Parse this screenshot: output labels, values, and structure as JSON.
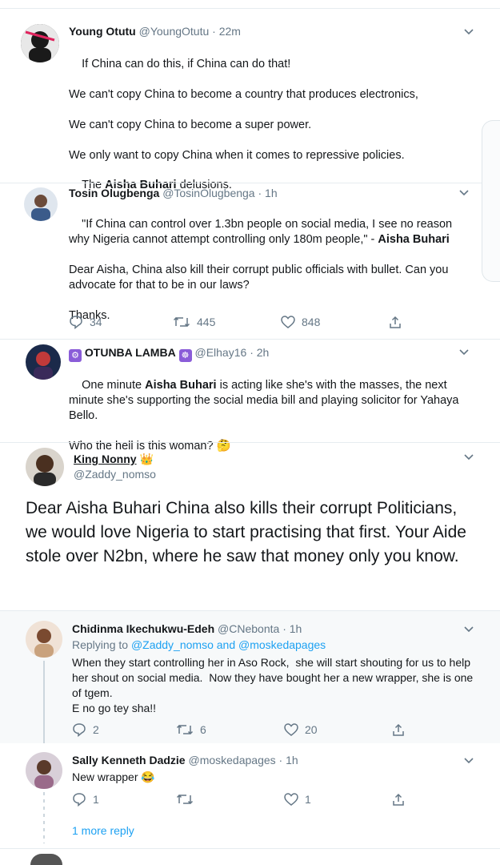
{
  "tweets": [
    {
      "name": "Young Otutu",
      "handle": "@YoungOtutu",
      "time": "22m",
      "body": "If China can do this, if China can do that!\n\nWe can't copy China to become a country that produces electronics,\n\nWe can't copy China to become a super power.\n\nWe only want to copy China when it comes to repressive policies.",
      "last_line_before": "The ",
      "last_line_bold": "Aisha Buhari",
      "last_line_after": " delusions."
    },
    {
      "name": "Tosin Olugbenga",
      "handle": "@TosinOlugbenga",
      "time": "1h",
      "body_a": "\"If China can control over 1.3bn people on social media, I see no reason why Nigeria cannot attempt controlling only 180m people,\" - ",
      "body_bold": "Aisha Buhari",
      "body_b": "\n\nDear Aisha, China also kill their corrupt public officials with bullet. Can you advocate for that to be in our laws?\n\nThanks.",
      "replies": "34",
      "retweets": "445",
      "likes": "848"
    },
    {
      "name": "OTUNBA LAMBA",
      "handle": "@Elhay16",
      "time": "2h",
      "body_a": "One minute ",
      "body_bold": "Aisha Buhari",
      "body_b": " is acting like she's with the masses, the next minute she's supporting the social media bill and playing solicitor for Yahaya Bello.\n\nWho the hell is this woman? 🤔"
    },
    {
      "name": "King Nonny",
      "handle": "@Zaddy_nomso",
      "body": "Dear Aisha Buhari China also kills their corrupt Politicians, we would love Nigeria to start practising that first. Your Aide stole over N2bn, where he saw that money only you know."
    },
    {
      "name": "Chidinma Ikechukwu-Edeh",
      "handle": "@CNebonta",
      "time": "1h",
      "replying_label": "Replying to ",
      "replying_users": "@Zaddy_nomso and @moskedapages",
      "body": "When they start controlling her in Aso Rock,  she will start shouting for us to help her shout on social media.  Now they have bought her a new wrapper, she is one of tgem.\nE no go tey sha!!",
      "replies": "2",
      "retweets": "6",
      "likes": "20"
    },
    {
      "name": "Sally Kenneth Dadzie",
      "handle": "@moskedapages",
      "time": "1h",
      "body": "New wrapper 😂",
      "replies": "1",
      "retweets": "",
      "likes": "1",
      "more_replies": "1 more reply"
    }
  ],
  "colors": {
    "accent": "#1da1f2",
    "muted": "#657786",
    "border": "#e6ecf0"
  }
}
